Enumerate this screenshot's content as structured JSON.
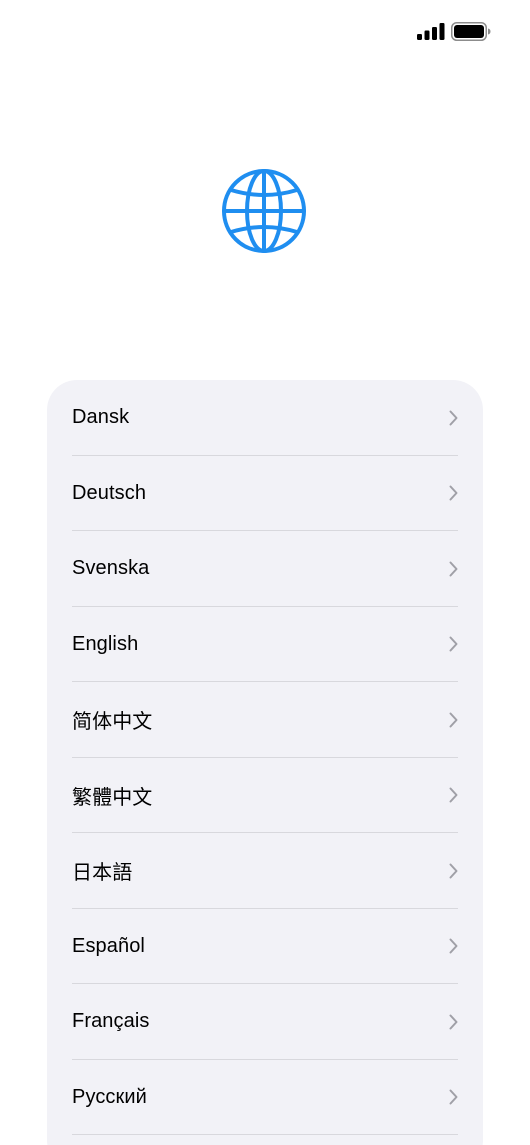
{
  "status_bar": {
    "signal_icon": "cellular-signal-icon",
    "battery_icon": "battery-icon",
    "battery_level": 1.0
  },
  "header": {
    "icon": "globe-icon",
    "accent_color": "#1f8ef0"
  },
  "languages": [
    {
      "label": "Dansk"
    },
    {
      "label": "Deutsch"
    },
    {
      "label": "Svenska"
    },
    {
      "label": "English"
    },
    {
      "label": "简体中文"
    },
    {
      "label": "繁體中文"
    },
    {
      "label": "日本語"
    },
    {
      "label": "Español"
    },
    {
      "label": "Français"
    },
    {
      "label": "Русский"
    }
  ],
  "row_icon": "chevron-right-icon"
}
